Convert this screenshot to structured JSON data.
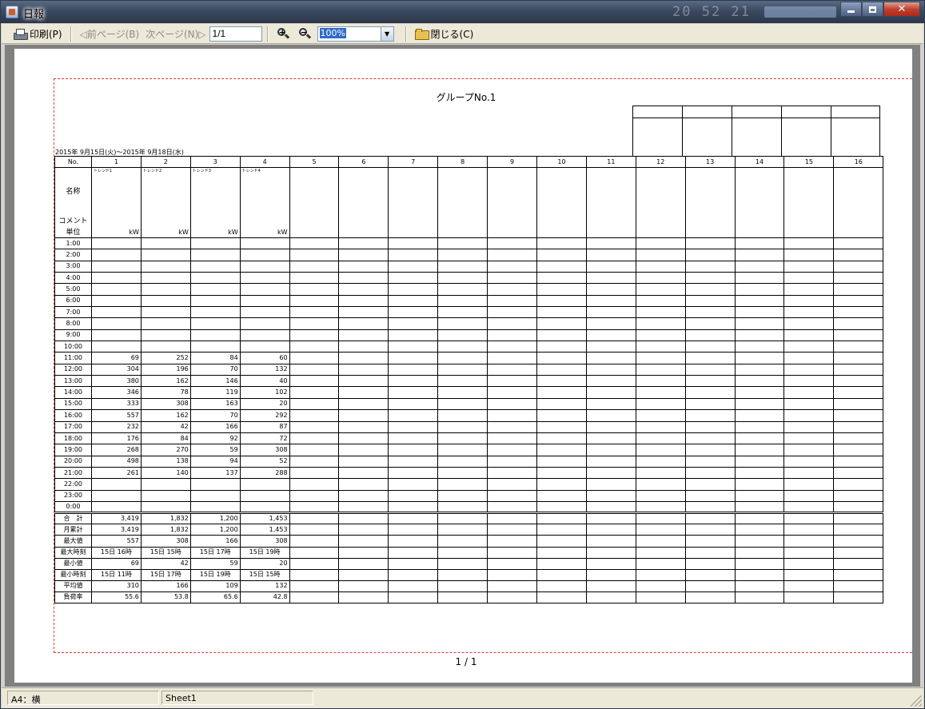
{
  "window": {
    "title": "日報"
  },
  "titlebar_bg": {
    "text": "20 52 21"
  },
  "toolbar": {
    "print_label": "印刷(P)",
    "prev_label": "◁前ページ(B)",
    "next_label": "次ページ(N)▷",
    "page_value": "1/1",
    "zoom_value": "100%",
    "close_label": "閉じる(C)"
  },
  "report": {
    "title": "グループNo.1",
    "date_range": "2015年 9月15日(火)～2015年 9月18日(水)",
    "page_number": "1 / 1",
    "no_header": "No.",
    "name_label": "名称",
    "comment_label": "コメント",
    "unit_label": "単位",
    "columns": [
      {
        "no": "1",
        "trend": "トレンド1",
        "unit": "kW"
      },
      {
        "no": "2",
        "trend": "トレンド2",
        "unit": "kW"
      },
      {
        "no": "3",
        "trend": "トレンド3",
        "unit": "kW"
      },
      {
        "no": "4",
        "trend": "トレンド4",
        "unit": "kW"
      },
      {
        "no": "5",
        "trend": "",
        "unit": ""
      },
      {
        "no": "6",
        "trend": "",
        "unit": ""
      },
      {
        "no": "7",
        "trend": "",
        "unit": ""
      },
      {
        "no": "8",
        "trend": "",
        "unit": ""
      },
      {
        "no": "9",
        "trend": "",
        "unit": ""
      },
      {
        "no": "10",
        "trend": "",
        "unit": ""
      },
      {
        "no": "11",
        "trend": "",
        "unit": ""
      },
      {
        "no": "12",
        "trend": "",
        "unit": ""
      },
      {
        "no": "13",
        "trend": "",
        "unit": ""
      },
      {
        "no": "14",
        "trend": "",
        "unit": ""
      },
      {
        "no": "15",
        "trend": "",
        "unit": ""
      },
      {
        "no": "16",
        "trend": "",
        "unit": ""
      }
    ],
    "hourly_rows": [
      {
        "time": "1:00",
        "values": [
          "",
          "",
          "",
          ""
        ]
      },
      {
        "time": "2:00",
        "values": [
          "",
          "",
          "",
          ""
        ]
      },
      {
        "time": "3:00",
        "values": [
          "",
          "",
          "",
          ""
        ]
      },
      {
        "time": "4:00",
        "values": [
          "",
          "",
          "",
          ""
        ]
      },
      {
        "time": "5:00",
        "values": [
          "",
          "",
          "",
          ""
        ]
      },
      {
        "time": "6:00",
        "values": [
          "",
          "",
          "",
          ""
        ]
      },
      {
        "time": "7:00",
        "values": [
          "",
          "",
          "",
          ""
        ]
      },
      {
        "time": "8:00",
        "values": [
          "",
          "",
          "",
          ""
        ]
      },
      {
        "time": "9:00",
        "values": [
          "",
          "",
          "",
          ""
        ]
      },
      {
        "time": "10:00",
        "values": [
          "",
          "",
          "",
          ""
        ]
      },
      {
        "time": "11:00",
        "values": [
          "69",
          "252",
          "84",
          "60"
        ]
      },
      {
        "time": "12:00",
        "values": [
          "304",
          "196",
          "70",
          "132"
        ]
      },
      {
        "time": "13:00",
        "values": [
          "380",
          "162",
          "146",
          "40"
        ]
      },
      {
        "time": "14:00",
        "values": [
          "346",
          "78",
          "119",
          "102"
        ]
      },
      {
        "time": "15:00",
        "values": [
          "333",
          "308",
          "163",
          "20"
        ]
      },
      {
        "time": "16:00",
        "values": [
          "557",
          "162",
          "70",
          "292"
        ]
      },
      {
        "time": "17:00",
        "values": [
          "232",
          "42",
          "166",
          "87"
        ]
      },
      {
        "time": "18:00",
        "values": [
          "176",
          "84",
          "92",
          "72"
        ]
      },
      {
        "time": "19:00",
        "values": [
          "268",
          "270",
          "59",
          "308"
        ]
      },
      {
        "time": "20:00",
        "values": [
          "498",
          "138",
          "94",
          "52"
        ]
      },
      {
        "time": "21:00",
        "values": [
          "261",
          "140",
          "137",
          "288"
        ]
      },
      {
        "time": "22:00",
        "values": [
          "",
          "",
          "",
          ""
        ]
      },
      {
        "time": "23:00",
        "values": [
          "",
          "",
          "",
          ""
        ]
      },
      {
        "time": "0:00",
        "values": [
          "",
          "",
          "",
          ""
        ]
      }
    ],
    "summary_rows": [
      {
        "label": "合　計",
        "values": [
          "3,419",
          "1,832",
          "1,200",
          "1,453"
        ]
      },
      {
        "label": "月累計",
        "values": [
          "3,419",
          "1,832",
          "1,200",
          "1,453"
        ]
      },
      {
        "label": "最大値",
        "values": [
          "557",
          "308",
          "166",
          "308"
        ]
      },
      {
        "label": "最大時刻",
        "values": [
          "15日 16時",
          "15日 15時",
          "15日 17時",
          "15日 19時"
        ],
        "center": true
      },
      {
        "label": "最小値",
        "values": [
          "69",
          "42",
          "59",
          "20"
        ]
      },
      {
        "label": "最小時刻",
        "values": [
          "15日 11時",
          "15日 17時",
          "15日 19時",
          "15日 15時"
        ],
        "center": true
      },
      {
        "label": "平均値",
        "values": [
          "310",
          "166",
          "109",
          "132"
        ]
      },
      {
        "label": "負荷率",
        "values": [
          "55.6",
          "53.8",
          "65.6",
          "42.8"
        ]
      }
    ]
  },
  "statusbar": {
    "paper": "A4：横",
    "sheet": "Sheet1"
  }
}
